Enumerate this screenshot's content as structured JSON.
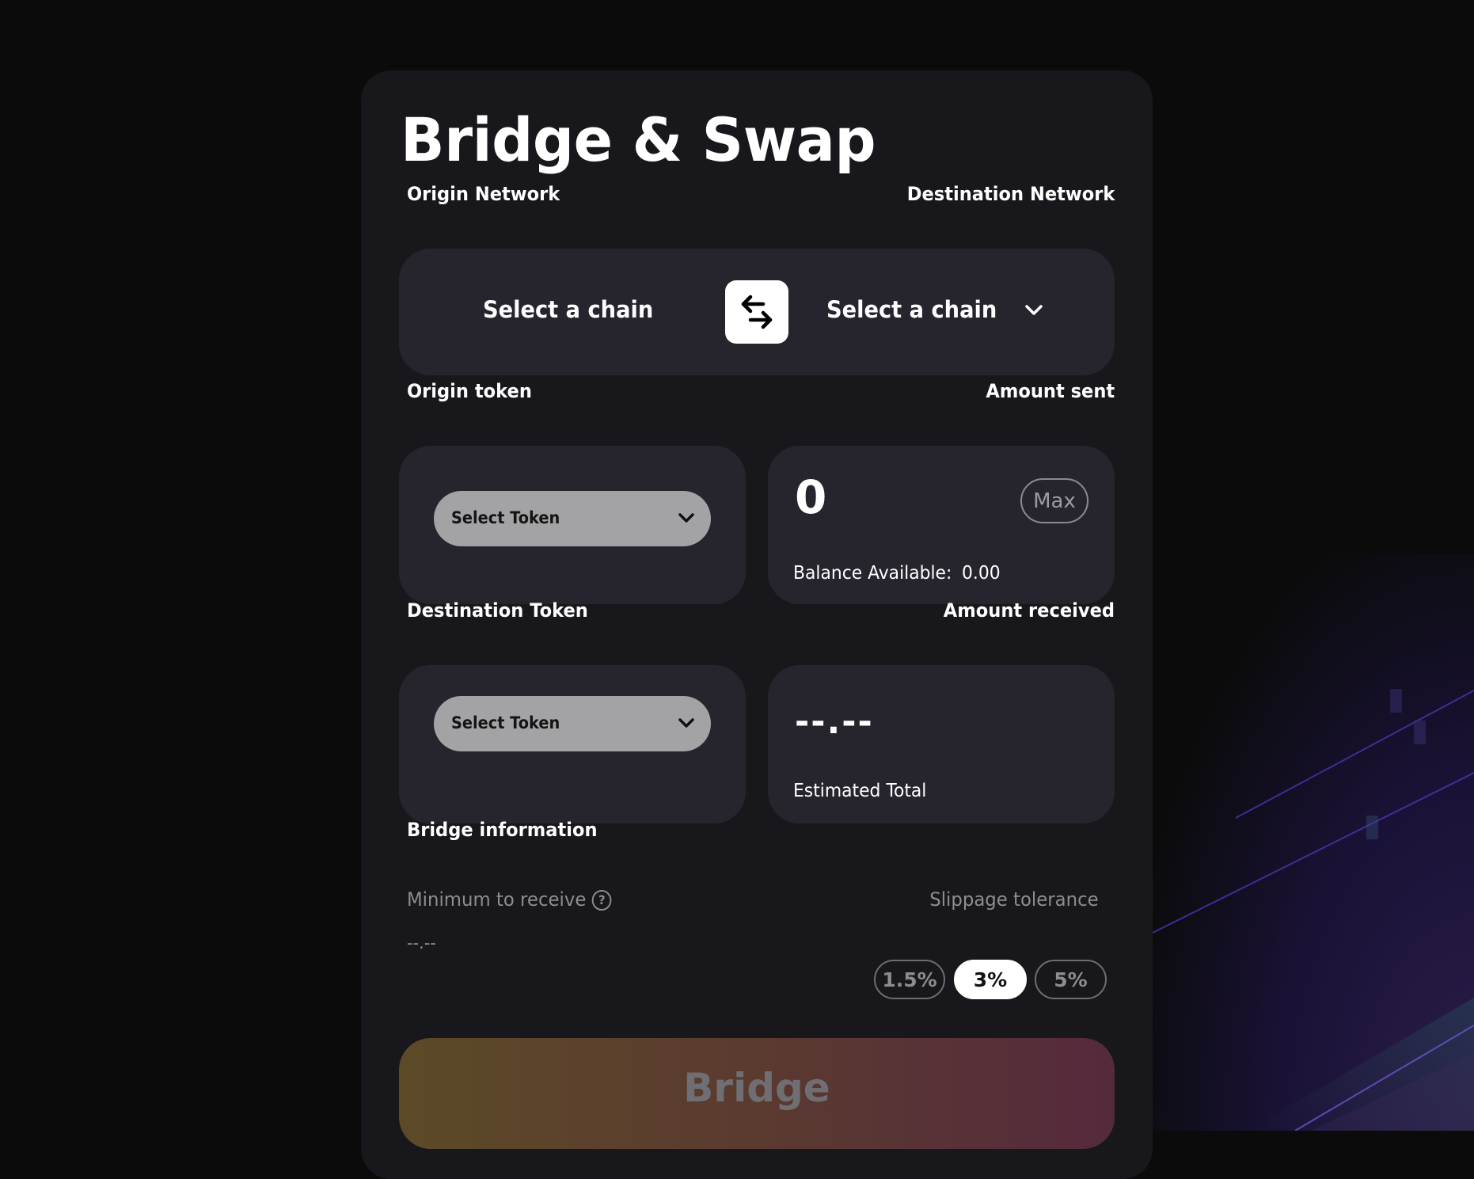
{
  "page": {
    "title": "Bridge & Swap"
  },
  "network": {
    "origin_label": "Origin Network",
    "destination_label": "Destination Network",
    "origin_value": "Select a chain",
    "destination_value": "Select a chain",
    "swap_icon": "swap-arrows-icon",
    "dropdown_icon": "chevron-down-icon"
  },
  "origin": {
    "token_label": "Origin token",
    "amount_label": "Amount sent",
    "token_select": "Select Token",
    "amount_value": "0",
    "max_label": "Max",
    "balance_label": "Balance Available:",
    "balance_value": "0.00"
  },
  "destination": {
    "token_label": "Destination Token",
    "amount_label": "Amount received",
    "token_select": "Select Token",
    "amount_value": "--.--",
    "estimate_label": "Estimated Total"
  },
  "info": {
    "heading": "Bridge information",
    "min_receive_label": "Minimum to receive",
    "min_receive_value": "--.--",
    "help_icon": "question-circle-icon",
    "slippage_label": "Slippage tolerance",
    "slippage_options": [
      "1.5%",
      "3%",
      "5%"
    ],
    "slippage_selected": "3%"
  },
  "actions": {
    "bridge_label": "Bridge"
  },
  "colors": {
    "background": "#0b0b0c",
    "card": "#18181c",
    "panel": "#26252e",
    "token_pill": "#a3a3a6",
    "bridge_gradient_start": "#5c4a27",
    "bridge_gradient_end": "#552a3d",
    "muted_text": "#8d8d91"
  }
}
